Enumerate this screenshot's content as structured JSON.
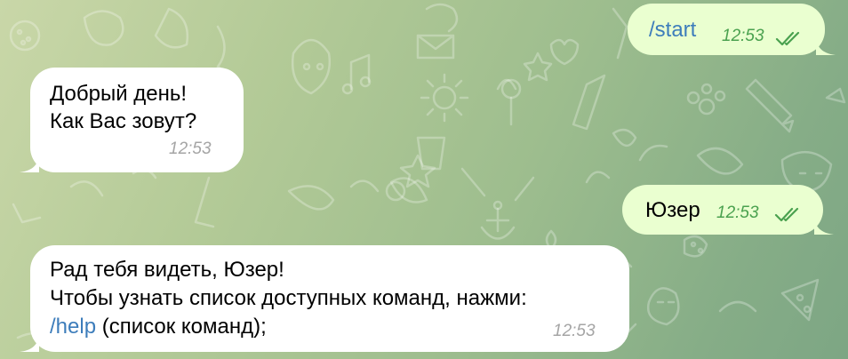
{
  "colors": {
    "incoming_bubble": "#ffffff",
    "outgoing_bubble": "#eaffd0",
    "outgoing_time": "#4aa14f",
    "incoming_time": "#a5a5a5",
    "command_link": "#3d7dbb"
  },
  "messages": [
    {
      "direction": "outgoing",
      "text": "/start",
      "is_command": true,
      "time": "12:53",
      "status_icon": "double-check-icon"
    },
    {
      "direction": "incoming",
      "lines": [
        "Добрый день!",
        "Как Вас зовут?"
      ],
      "time": "12:53"
    },
    {
      "direction": "outgoing",
      "text": "Юзер",
      "time": "12:53",
      "status_icon": "double-check-icon"
    },
    {
      "direction": "incoming",
      "lines": [
        "Рад тебя видеть, Юзер!",
        "Чтобы узнать список доступных команд, нажми:"
      ],
      "command": "/help",
      "command_suffix": " (список команд);",
      "time": "12:53"
    }
  ]
}
